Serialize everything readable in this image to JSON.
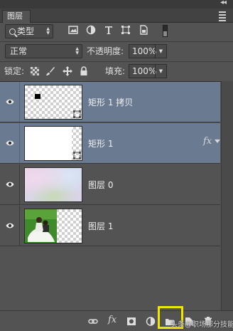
{
  "panel": {
    "tab_label": "图层"
  },
  "filter": {
    "kind_label": "类型",
    "icons": [
      "image-filter-icon",
      "adjustment-filter-icon",
      "type-filter-icon",
      "shape-filter-icon",
      "smart-object-filter-icon"
    ]
  },
  "blend": {
    "mode": "正常",
    "opacity_label": "不透明度:",
    "opacity_value": "100%"
  },
  "locks": {
    "label": "锁定:",
    "icons": [
      "lock-transparent-pixels-icon",
      "lock-image-pixels-icon",
      "lock-position-icon",
      "lock-all-icon"
    ],
    "fill_label": "填充:",
    "fill_value": "100%"
  },
  "layers": [
    {
      "name": "矩形 1 拷贝",
      "selected": true,
      "thumb": "shape-black-rect",
      "has_fx": false
    },
    {
      "name": "矩形 1",
      "selected": true,
      "thumb": "shape-white",
      "has_fx": true,
      "fx_label": "fx"
    },
    {
      "name": "图层 0",
      "selected": false,
      "thumb": "pastel-photo",
      "has_fx": false
    },
    {
      "name": "图层 1",
      "selected": false,
      "thumb": "wedding-photo",
      "has_fx": false
    }
  ],
  "footer": {
    "icons": [
      "link-layers-icon",
      "add-style-icon",
      "add-mask-icon",
      "new-adjustment-icon",
      "new-group-icon",
      "new-layer-icon",
      "delete-layer-icon"
    ],
    "fx_label": "fx",
    "watermark": "头条@职场那分技能"
  },
  "colors": {
    "panel_bg": "#535353",
    "selected_row": "#6a7a91",
    "highlight": "#f2e600"
  }
}
